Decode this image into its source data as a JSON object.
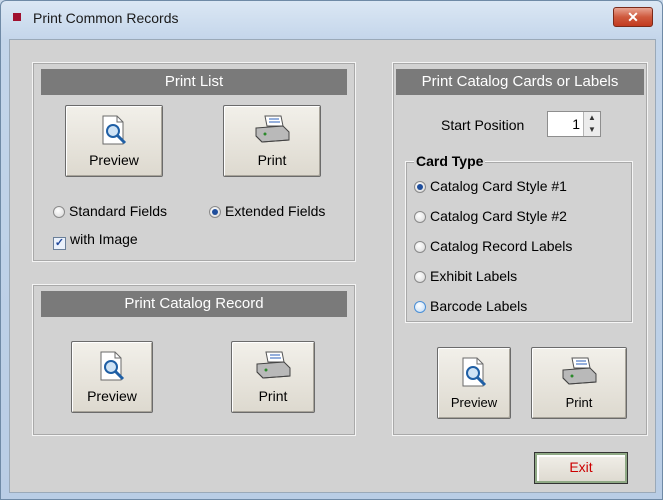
{
  "window": {
    "title": "Print Common Records",
    "close_glyph": "✕"
  },
  "print_list": {
    "title": "Print List",
    "preview_label": "Preview",
    "print_label": "Print",
    "fields_options": [
      {
        "label": "Standard Fields",
        "selected": false
      },
      {
        "label": "Extended Fields",
        "selected": true
      }
    ],
    "with_image": {
      "label": "with Image",
      "checked": true,
      "check_glyph": "✓"
    }
  },
  "print_catalog_record": {
    "title": "Print Catalog Record",
    "preview_label": "Preview",
    "print_label": "Print"
  },
  "catalog_cards": {
    "title": "Print Catalog Cards or Labels",
    "start_position_label": "Start Position",
    "start_position_value": "1",
    "card_type_title": "Card Type",
    "card_types": [
      {
        "label": "Catalog Card Style #1",
        "selected": true
      },
      {
        "label": "Catalog Card Style #2",
        "selected": false
      },
      {
        "label": "Catalog Record Labels",
        "selected": false
      },
      {
        "label": "Exhibit Labels",
        "selected": false
      },
      {
        "label": "Barcode Labels",
        "selected": false
      }
    ],
    "preview_label": "Preview",
    "print_label": "Print"
  },
  "exit_label": "Exit",
  "icons": {
    "preview": "magnifier-page-icon",
    "print": "printer-icon",
    "app": "app-icon",
    "close": "close-icon"
  },
  "colors": {
    "group_title_bg": "#7a7a7a",
    "exit_text": "#cc0000",
    "app_icon": "#a0102e"
  }
}
